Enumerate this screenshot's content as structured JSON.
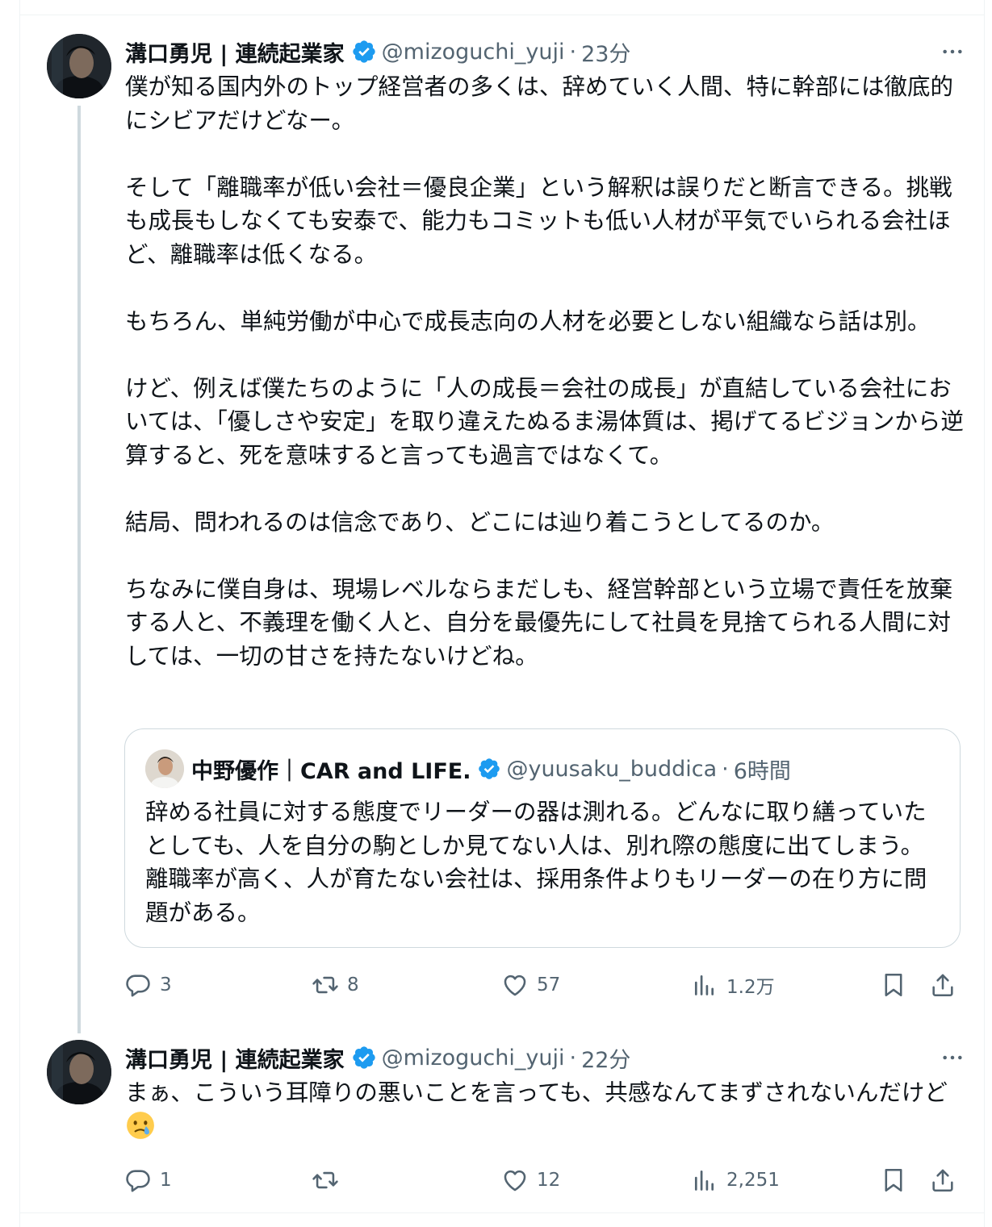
{
  "tweets": [
    {
      "author": {
        "name": "溝口勇児 | 連続起業家",
        "handle": "@mizoguchi_yuji",
        "time": "23分"
      },
      "text": "僕が知る国内外のトップ経営者の多くは、辞めていく人間、特に幹部には徹底的にシビアだけどなー。\n\nそして「離職率が低い会社＝優良企業」という解釈は誤りだと断言できる。挑戦も成長もしなくても安泰で、能力もコミットも低い人材が平気でいられる会社ほど、離職率は低くなる。\n\nもちろん、単純労働が中心で成長志向の人材を必要としない組織なら話は別。\n\nけど、例えば僕たちのように「人の成長＝会社の成長」が直結している会社においては、「優しさや安定」を取り違えたぬるま湯体質は、掲げてるビジョンから逆算すると、死を意味すると言っても過言ではなくて。\n\n結局、問われるのは信念であり、どこには辿り着こうとしてるのか。\n\nちなみに僕自身は、現場レベルならまだしも、経営幹部という立場で責任を放棄する人と、不義理を働く人と、自分を最優先にして社員を見捨てられる人間に対しては、一切の甘さを持たないけどね。",
      "quote": {
        "name": "中野優作｜CAR and LIFE.",
        "handle": "@yuusaku_buddica",
        "time": "6時間",
        "text": "辞める社員に対する態度でリーダーの器は測れる。どんなに取り繕っていたとしても、人を自分の駒としか見てない人は、別れ際の態度に出てしまう。離職率が高く、人が育たない会社は、採用条件よりもリーダーの在り方に問題がある。"
      },
      "stats": {
        "replies": "3",
        "reposts": "8",
        "likes": "57",
        "views": "1.2万"
      }
    },
    {
      "author": {
        "name": "溝口勇児 | 連続起業家",
        "handle": "@mizoguchi_yuji",
        "time": "22分"
      },
      "text": "まぁ、こういう耳障りの悪いことを言っても、共感なんてまずされないんだけど",
      "emoji": "crying-face-emoji",
      "stats": {
        "replies": "1",
        "reposts": "",
        "likes": "12",
        "views": "2,251"
      }
    }
  ],
  "colors": {
    "text": "#0f1419",
    "secondary": "#536471",
    "border": "#cfd9de",
    "verified": "#1d9bf0"
  },
  "icons": [
    "more-icon",
    "verified-icon",
    "reply-icon",
    "repost-icon",
    "like-icon",
    "views-icon",
    "bookmark-icon",
    "share-icon"
  ]
}
